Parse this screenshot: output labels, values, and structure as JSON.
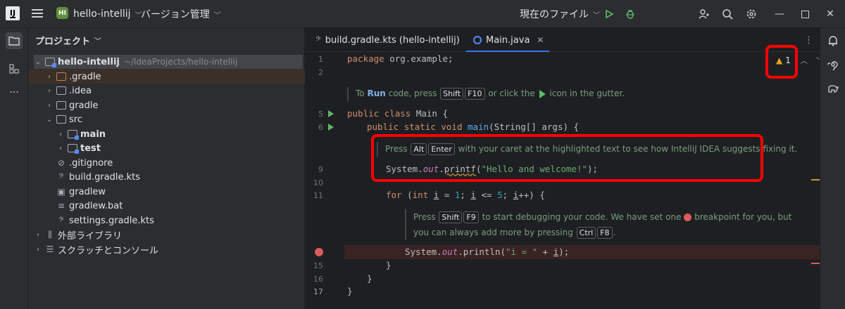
{
  "titlebar": {
    "app_logo": "IJ",
    "project_badge": "HI",
    "project_name": "hello-intellij",
    "vcs_menu": "バージョン管理",
    "run_config": "現在のファイル"
  },
  "project_panel": {
    "title": "プロジェクト",
    "tree": [
      {
        "label": "hello-intellij",
        "path": "~/IdeaProjects/hello-intellij"
      },
      {
        "label": ".gradle"
      },
      {
        "label": ".idea"
      },
      {
        "label": "gradle"
      },
      {
        "label": "src"
      },
      {
        "label": "main"
      },
      {
        "label": "test"
      },
      {
        "label": ".gitignore"
      },
      {
        "label": "build.gradle.kts"
      },
      {
        "label": "gradlew"
      },
      {
        "label": "gradlew.bat"
      },
      {
        "label": "settings.gradle.kts"
      },
      {
        "label": "外部ライブラリ"
      },
      {
        "label": "スクラッチとコンソール"
      }
    ]
  },
  "tabs": [
    {
      "label": "build.gradle.kts (hello-intellij)"
    },
    {
      "label": "Main.java"
    }
  ],
  "editor": {
    "line_numbers": [
      "1",
      "2",
      "5",
      "6",
      "9",
      "10",
      "11",
      "15",
      "16",
      "17"
    ],
    "warning_count": "1",
    "code": {
      "l1_kw": "package",
      "l1_rest": " org.example;",
      "l5_kw1": "public",
      "l5_kw2": "class",
      "l5_rest": " Main {",
      "l6_kw1": "public",
      "l6_kw2": "static",
      "l6_kw3": "void",
      "l6_fn": "main",
      "l6_rest": "(String[] args) {",
      "l9_a": "System.",
      "l9_out": "out",
      "l9_dot": ".",
      "l9_fn": "printf",
      "l9_paren": "(",
      "l9_str": "\"Hello and welcome!\"",
      "l9_end": ");",
      "l11_for": "for",
      "l11_p1": " (",
      "l11_int": "int",
      "l11_i1": "i",
      "l11_eq": " = ",
      "l11_one": "1",
      "l11_semi": "; ",
      "l11_i2": "i",
      "l11_le": " <= ",
      "l11_five": "5",
      "l11_semi2": "; ",
      "l11_i3": "i",
      "l11_end": "++) {",
      "l14_a": "System.",
      "l14_out": "out",
      "l14_b": ".println(",
      "l14_str": "\"i = \"",
      "l14_plus": " + ",
      "l14_i": "i",
      "l14_end": ");",
      "l15": "}",
      "l16": "}",
      "l17": "}"
    },
    "hint1": {
      "to": "To ",
      "run": "Run",
      "mid": " code, press ",
      "k1": "Shift",
      "k2": "F10",
      "rest": " or click the ",
      "end": " icon in the gutter."
    },
    "hint2": {
      "press": "Press ",
      "k1": "Alt",
      "k2": "Enter",
      "rest": " with your caret at the highlighted text to see how IntelliJ IDEA suggests fixing it."
    },
    "hint3": {
      "press": "Press ",
      "k1": "Shift",
      "k2": "F9",
      "rest1": " to start debugging your code. We have set one ",
      "rest2": " breakpoint for you, but",
      "line2": "you can always add more by pressing ",
      "k3": "Ctrl",
      "k4": "F8",
      "end": "."
    }
  },
  "colors": {
    "accent": "#3574f0",
    "highlight_box": "#ff0000",
    "breakpoint": "#db5c5c",
    "run": "#5fb865"
  }
}
